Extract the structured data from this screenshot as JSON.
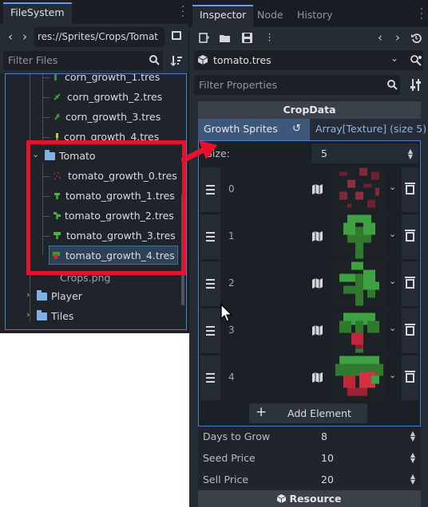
{
  "filesystem": {
    "tab": "FileSystem",
    "path": "res://Sprites/Crops/Tomat",
    "filter_placeholder": "Filter Files",
    "items": [
      {
        "label": "corn_growth_1.tres",
        "color": "#3a8d2f"
      },
      {
        "label": "corn_growth_2.tres",
        "color": "#3f9a35"
      },
      {
        "label": "corn_growth_3.tres",
        "color": "#3f9a35"
      },
      {
        "label": "corn_growth_4.tres",
        "color": "#d8c234"
      },
      {
        "label": "Tomato",
        "color": "#7fb3e8"
      },
      {
        "label": "tomato_growth_0.tres",
        "color": "#8a2a3a"
      },
      {
        "label": "tomato_growth_1.tres",
        "color": "#3f9a35"
      },
      {
        "label": "tomato_growth_2.tres",
        "color": "#3f9a35"
      },
      {
        "label": "tomato_growth_3.tres",
        "color": "#3f9a35"
      },
      {
        "label": "tomato_growth_4.tres",
        "color": "#c6283a"
      },
      {
        "label": "Crops.png",
        "color": ""
      },
      {
        "label": "Player",
        "color": "#7fb3e8"
      },
      {
        "label": "Tiles",
        "color": "#7fb3e8"
      }
    ]
  },
  "inspector": {
    "tabs": [
      "Inspector",
      "Node",
      "History"
    ],
    "resource": "tomato.tres",
    "filter_placeholder": "Filter Properties",
    "category": "CropData",
    "growth_sprites": {
      "label": "Growth Sprites",
      "value": "Array[Texture] (size 5)"
    },
    "size": {
      "label": "Size:",
      "value": "5"
    },
    "elements": [
      {
        "index": "0"
      },
      {
        "index": "1"
      },
      {
        "index": "2"
      },
      {
        "index": "3"
      },
      {
        "index": "4"
      }
    ],
    "add_element": "Add Element",
    "properties": [
      {
        "label": "Days to Grow",
        "value": "8"
      },
      {
        "label": "Seed Price",
        "value": "10"
      },
      {
        "label": "Sell Price",
        "value": "20"
      }
    ],
    "bottom_category": "Resource"
  },
  "colors": {
    "accent": "#4c7ec9",
    "annotation": "#e8112d",
    "selection": "#3d587a"
  }
}
